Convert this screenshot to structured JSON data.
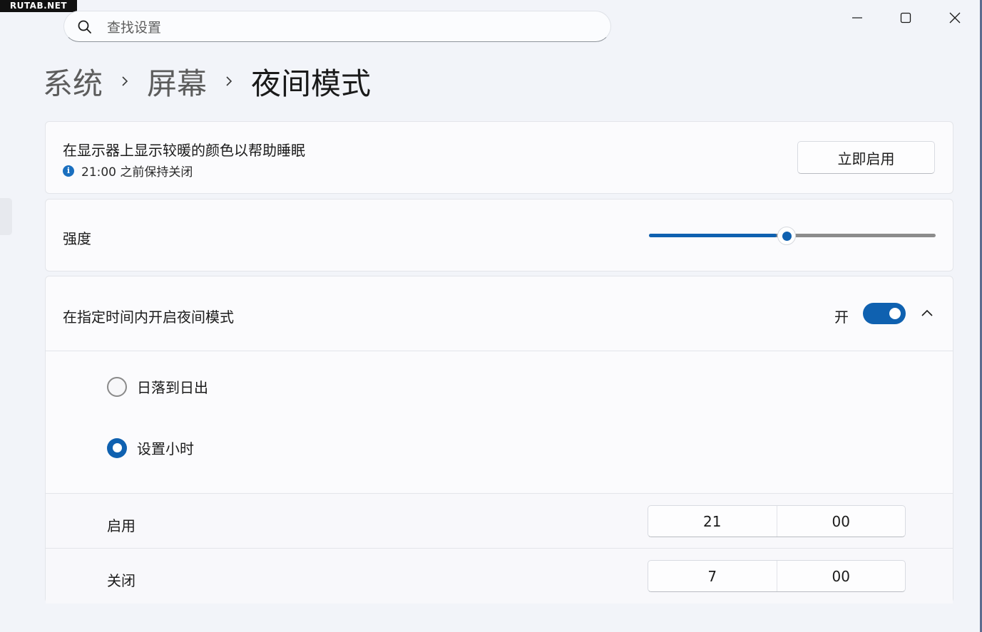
{
  "watermark": "RUTAB.NET",
  "search": {
    "placeholder": "查找设置",
    "value": ""
  },
  "breadcrumb": {
    "items": [
      "系统",
      "屏幕"
    ],
    "current": "夜间模式"
  },
  "night_light": {
    "description": "在显示器上显示较暖的颜色以帮助睡眠",
    "status": "21:00 之前保持关闭",
    "action_button": "立即启用"
  },
  "strength": {
    "label": "强度",
    "value_percent": 48
  },
  "schedule": {
    "label": "在指定时间内开启夜间模式",
    "toggle_state": "开",
    "toggle_on": true,
    "expanded": true,
    "options": [
      {
        "label": "日落到日出",
        "selected": false
      },
      {
        "label": "设置小时",
        "selected": true
      }
    ],
    "turn_on": {
      "label": "启用",
      "hour": "21",
      "minute": "00"
    },
    "turn_off": {
      "label": "关闭",
      "hour": "7",
      "minute": "00"
    }
  },
  "colors": {
    "accent": "#0f61b0",
    "background": "#f2f4f9",
    "card": "#fbfbfd"
  }
}
